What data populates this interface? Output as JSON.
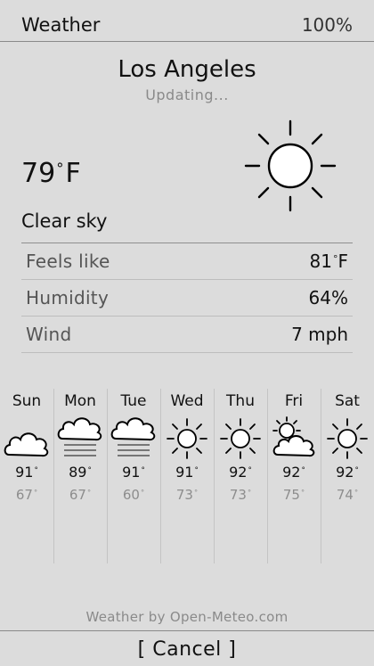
{
  "header": {
    "title": "Weather",
    "battery": "100%"
  },
  "location": {
    "city": "Los Angeles",
    "status": "Updating..."
  },
  "current": {
    "temperature": "79",
    "degree_symbol": "°",
    "unit": "F",
    "condition": "Clear sky",
    "icon": "sun-icon"
  },
  "details": [
    {
      "label": "Feels like",
      "value": "81",
      "degree": "°",
      "unit": "F"
    },
    {
      "label": "Humidity",
      "value": "64%"
    },
    {
      "label": "Wind",
      "value": "7 mph"
    }
  ],
  "forecast": [
    {
      "day": "Sun",
      "icon": "cloud-icon",
      "high": "91",
      "low": "67"
    },
    {
      "day": "Mon",
      "icon": "fog-icon",
      "high": "89",
      "low": "67"
    },
    {
      "day": "Tue",
      "icon": "fog-icon",
      "high": "91",
      "low": "60"
    },
    {
      "day": "Wed",
      "icon": "sun-icon",
      "high": "91",
      "low": "73"
    },
    {
      "day": "Thu",
      "icon": "sun-icon",
      "high": "92",
      "low": "73"
    },
    {
      "day": "Fri",
      "icon": "partly-cloudy-icon",
      "high": "92",
      "low": "75"
    },
    {
      "day": "Sat",
      "icon": "sun-icon",
      "high": "92",
      "low": "74"
    }
  ],
  "degree": "°",
  "footer": {
    "attribution": "Weather by Open-Meteo.com",
    "cancel_label": "[ Cancel ]"
  }
}
